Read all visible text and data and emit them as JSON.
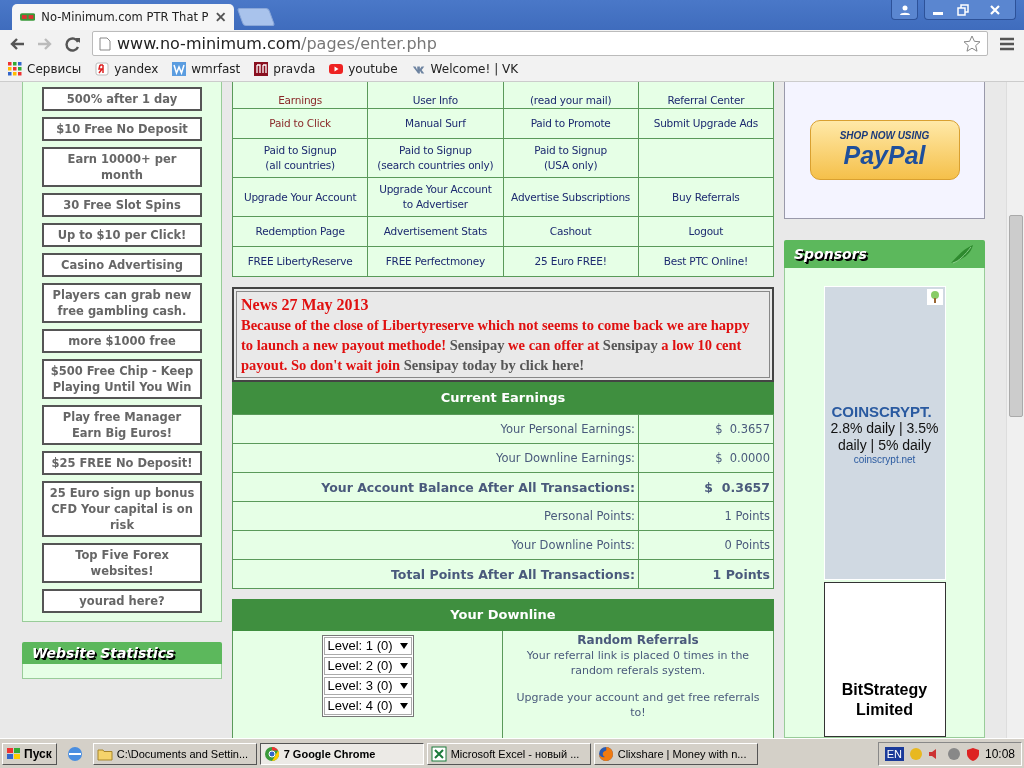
{
  "browser": {
    "tab_title": "No-Minimum.com PTR That P",
    "url_host": "www.no-minimum.com",
    "url_path": "/pages/enter.php",
    "bookmarks": [
      {
        "label": "Сервисы",
        "kind": "apps"
      },
      {
        "label": "yandex",
        "kind": "yandex"
      },
      {
        "label": "wmrfast",
        "kind": "wmr"
      },
      {
        "label": "pravda",
        "kind": "pravda"
      },
      {
        "label": "youtube",
        "kind": "youtube"
      },
      {
        "label": "Welcome! | VK",
        "kind": "vk"
      }
    ]
  },
  "left_ads": [
    "500% after 1 day",
    "$10 Free No Deposit",
    "Earn 10000+ per month",
    "30 Free Slot Spins",
    "Up to $10 per Click!",
    "Casino Advertising",
    "Players can grab new free gambling cash.",
    "more $1000 free",
    "$500 Free Chip - Keep Playing Until You Win",
    "Play free Manager Earn Big Euros!",
    "$25 FREE No Deposit!",
    "25 Euro sign up bonus CFD Your capital is on risk",
    "Top Five Forex websites!",
    "yourad here?"
  ],
  "left_heading": "Website Statistics",
  "menu": {
    "rows": [
      [
        {
          "lines": [
            "Earnings"
          ],
          "visited": true
        },
        {
          "lines": [
            "User Info"
          ],
          "visited": false
        },
        {
          "lines": [
            "(read your mail)"
          ],
          "visited": false
        },
        {
          "lines": [
            "Referral Center"
          ],
          "visited": false
        }
      ],
      [
        {
          "lines": [
            "Paid to Click"
          ],
          "visited": true
        },
        {
          "lines": [
            "Manual Surf"
          ],
          "visited": false
        },
        {
          "lines": [
            "Paid to Promote"
          ],
          "visited": false
        },
        {
          "lines": [
            "Submit Upgrade Ads"
          ],
          "visited": false
        }
      ],
      [
        {
          "lines": [
            "Paid to Signup",
            "(all countries)"
          ],
          "visited": false
        },
        {
          "lines": [
            "Paid to Signup",
            "(search countries only)"
          ],
          "visited": false
        },
        {
          "lines": [
            "Paid to Signup",
            "(USA only)"
          ],
          "visited": false
        }
      ],
      [
        {
          "lines": [
            "Upgrade Your Account"
          ],
          "visited": false
        },
        {
          "lines": [
            "Upgrade Your Account",
            "to Advertiser"
          ],
          "visited": false
        },
        {
          "lines": [
            "Advertise Subscriptions"
          ],
          "visited": false
        },
        {
          "lines": [
            "Buy Referrals"
          ],
          "visited": false
        }
      ],
      [
        {
          "lines": [
            "Redemption Page"
          ],
          "visited": false
        },
        {
          "lines": [
            "Advertisement Stats"
          ],
          "visited": false
        },
        {
          "lines": [
            "Cashout"
          ],
          "visited": false
        },
        {
          "lines": [
            "Logout"
          ],
          "visited": false
        }
      ],
      [
        {
          "lines": [
            "FREE LibertyReserve"
          ],
          "visited": false
        },
        {
          "lines": [
            "FREE Perfectmoney"
          ],
          "visited": false
        },
        {
          "lines": [
            "25 Euro FREE!"
          ],
          "visited": false
        },
        {
          "lines": [
            "Best PTC Online!"
          ],
          "visited": false
        }
      ]
    ]
  },
  "news": {
    "title": "News 27 May 2013",
    "segments": [
      {
        "text": "Because of the close of Libertyreserve which not seems to come back we are happy to launch a new payout methode! ",
        "color": "#e01010"
      },
      {
        "text": "Sensipay ",
        "color": "#555555"
      },
      {
        "text": "we can offer at ",
        "color": "#e01010"
      },
      {
        "text": "Sensipay ",
        "color": "#555555"
      },
      {
        "text": "a low 10 cent payout. So don't wait join ",
        "color": "#e01010"
      },
      {
        "text": "Sensipay today by click here!",
        "color": "#555555"
      }
    ]
  },
  "earnings": {
    "title": "Current Earnings",
    "rows": [
      {
        "label": "Your Personal Earnings:",
        "value": "$  0.3657",
        "emphasis": false
      },
      {
        "label": "Your Downline Earnings:",
        "value": "$  0.0000",
        "emphasis": false
      },
      {
        "label": "Your Account Balance After All Transactions:",
        "value": "$  0.3657",
        "emphasis": true
      },
      {
        "label": "Personal Points:",
        "value": "1 Points",
        "emphasis": false
      },
      {
        "label": "Your Downline Points:",
        "value": "0 Points",
        "emphasis": false
      },
      {
        "label": "Total Points After All Transactions:",
        "value": "1 Points",
        "emphasis": true
      }
    ]
  },
  "downline": {
    "title": "Your Downline",
    "levels": [
      "Level: 1 (0)",
      "Level: 2 (0)",
      "Level: 3 (0)",
      "Level: 4 (0)"
    ],
    "random_title": "Random Referrals",
    "random_text": "Your referral link is placed 0 times in the random referals system.",
    "upgrade_text": "Upgrade your account and get free referrals to!"
  },
  "right": {
    "paypal_top": "SHOP NOW USING",
    "paypal_brand": "PayPal",
    "sponsors_title": "Sponsors",
    "coinscrypt": {
      "title": "COINSCRYPT.",
      "rates": "2.8% daily | 3.5% daily | 5% daily",
      "domain": "coinscrypt.net"
    },
    "bitstrategy": "BitStrategy Limited"
  },
  "taskbar": {
    "start": "Пуск",
    "tasks": [
      {
        "label": "C:\\Documents and Settin...",
        "kind": "folder",
        "selected": false
      },
      {
        "label": "7 Google Chrome",
        "kind": "chrome",
        "selected": true
      },
      {
        "label": "Microsoft Excel - новый ...",
        "kind": "excel",
        "selected": false
      },
      {
        "label": "Clixshare | Money with n...",
        "kind": "firefox",
        "selected": false
      }
    ],
    "language": "EN",
    "clock": "10:08"
  }
}
